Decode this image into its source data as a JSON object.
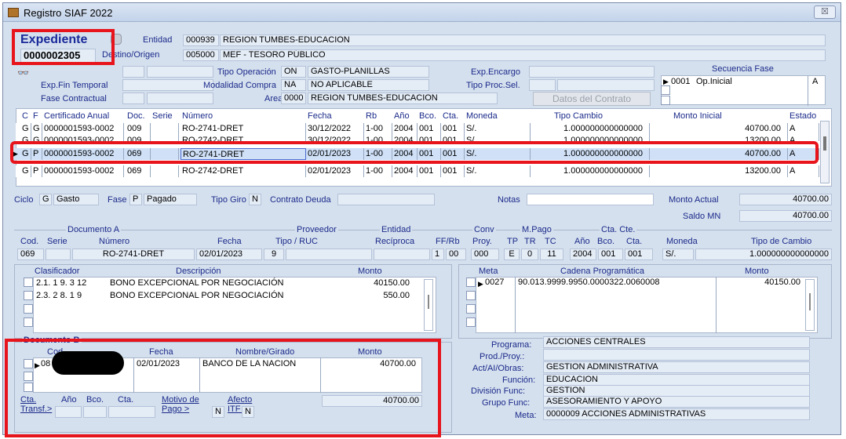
{
  "window": {
    "title": "Registro SIAF 2022",
    "close_label": "☒"
  },
  "expediente": {
    "label": "Expediente",
    "number": "0000002305",
    "entidad_label": "Entidad",
    "entidad_code": "000939",
    "entidad_name": "REGION TUMBES-EDUCACION",
    "destino_label": "Destino/Origen",
    "destino_code": "005000",
    "destino_name": "MEF - TESORO PÚBLICO"
  },
  "header": {
    "tipo_operacion_label": "Tipo Operación",
    "tipo_operacion_code": "ON",
    "tipo_operacion_value": "GASTO-PLANILLAS",
    "exp_encargo_label": "Exp.Encargo",
    "exp_fin_temporal_label": "Exp.Fin Temporal",
    "modalidad_compra_label": "Modalidad Compra",
    "modalidad_compra_code": "NA",
    "modalidad_compra_value": "NO APLICABLE",
    "tipo_proc_sel_label": "Tipo Proc.Sel.",
    "fase_contractual_label": "Fase Contractual",
    "area_label": "Area",
    "area_code": "0000",
    "area_value": "REGION TUMBES-EDUCACION",
    "datos_contrato_label": "Datos del Contrato"
  },
  "secuencia": {
    "title": "Secuencia Fase",
    "code": "0001",
    "name": "Op.Inicial",
    "state": "A"
  },
  "grid": {
    "headers": [
      "C",
      "F",
      "Certificado Anual",
      "Doc.",
      "Serie",
      "Número",
      "Fecha",
      "Rb",
      "Año",
      "Bco.",
      "Cta.",
      "Moneda",
      "Tipo Cambio",
      "Monto Inicial",
      "Estado"
    ],
    "rows": [
      [
        "G",
        "G",
        "0000001593-0002",
        "009",
        "",
        "RO-2741-DRET",
        "30/12/2022",
        "1-00",
        "2004",
        "001",
        "001",
        "S/.",
        "1.000000000000000",
        "40700.00",
        "A"
      ],
      [
        "G",
        "G",
        "0000001593-0002",
        "009",
        "",
        "RO-2742-DRET",
        "30/12/2022",
        "1-00",
        "2004",
        "001",
        "001",
        "S/.",
        "1.000000000000000",
        "13200.00",
        "A"
      ],
      [
        "G",
        "P",
        "0000001593-0002",
        "069",
        "",
        "RO-2741-DRET",
        "02/01/2023",
        "1-00",
        "2004",
        "001",
        "001",
        "S/.",
        "1.000000000000000",
        "40700.00",
        "A"
      ],
      [
        "G",
        "P",
        "0000001593-0002",
        "069",
        "",
        "RO-2742-DRET",
        "02/01/2023",
        "1-00",
        "2004",
        "001",
        "001",
        "S/.",
        "1.000000000000000",
        "13200.00",
        "A"
      ]
    ]
  },
  "summary": {
    "ciclo_label": "Ciclo",
    "ciclo_code": "G",
    "ciclo_value": "Gasto",
    "fase_label": "Fase",
    "fase_code": "P",
    "fase_value": "Pagado",
    "tipo_giro_label": "Tipo Giro",
    "tipo_giro_code": "N",
    "contrato_deuda_label": "Contrato Deuda",
    "notas_label": "Notas",
    "monto_actual_label": "Monto Actual",
    "monto_actual_value": "40700.00",
    "saldo_mn_label": "Saldo MN",
    "saldo_mn_value": "40700.00"
  },
  "documento": {
    "group_label": "Documento A",
    "proveedor_label": "Proveedor",
    "entidad_label": "Entidad",
    "conv_label": "Conv",
    "mpago_label": "M.Pago",
    "cta_cte_label": "Cta. Cte.",
    "col_cod": "Cod.",
    "col_serie": "Serie",
    "col_numero": "Número",
    "col_fecha": "Fecha",
    "col_tipo_ruc": "Tipo / RUC",
    "col_reciproca": "Recíproca",
    "col_ffrb": "FF/Rb",
    "col_proy": "Proy.",
    "col_tp": "TP",
    "col_tr": "TR",
    "col_tc": "TC",
    "col_anio": "Año",
    "col_bco": "Bco.",
    "col_cta": "Cta.",
    "col_moneda": "Moneda",
    "col_tipo_cambio": "Tipo de Cambio",
    "cod": "069",
    "numero": "RO-2741-DRET",
    "fecha": "02/01/2023",
    "tipo": "9",
    "ff": "1",
    "rb": "00",
    "proy": "000",
    "tp": "E",
    "tr": "0",
    "tc": "11",
    "anio": "2004",
    "bco": "001",
    "cta": "001",
    "moneda": "S/.",
    "tipo_cambio": "1.000000000000000"
  },
  "clasificador": {
    "col_clasificador": "Clasificador",
    "col_descripcion": "Descripción",
    "col_monto": "Monto",
    "rows": [
      {
        "code": "2.1. 1 9. 3 12",
        "desc": "BONO EXCEPCIONAL POR NEGOCIACIÓN",
        "monto": "40150.00"
      },
      {
        "code": "2.3. 2 8. 1 9",
        "desc": "BONO EXCEPCIONAL POR NEGOCIACIÓN",
        "monto": "550.00"
      }
    ]
  },
  "meta": {
    "col_meta": "Meta",
    "col_cadena": "Cadena Programática",
    "col_monto": "Monto",
    "code": "0027",
    "cadena": "90.013.9999.9950.0000322.0060008",
    "monto": "40150.00"
  },
  "documento_b": {
    "group_label": "Documento B",
    "col_cod": "Cod.",
    "col_fecha": "Fecha",
    "col_nombre": "Nombre/Girado",
    "col_monto": "Monto",
    "cod": "08",
    "fecha": "02/01/2023",
    "nombre": "BANCO DE LA NACION",
    "monto": "40700.00",
    "total": "40700.00",
    "cta_transf_label": "Cta. Transf.>",
    "anio_label": "Año",
    "bco_label": "Bco.",
    "cta_label": "Cta.",
    "motivo_label": "Motivo de Pago >",
    "motivo_value": "N",
    "afecto_label": "Afecto ITF >",
    "afecto_value": "N"
  },
  "programa": {
    "programa_label": "Programa:",
    "programa_value": "ACCIONES CENTRALES",
    "prod_label": "Prod./Proy.:",
    "act_label": "Act/AI/Obras:",
    "act_value": "GESTION ADMINISTRATIVA",
    "funcion_label": "Función:",
    "funcion_value": "EDUCACION",
    "division_label": "División Func:",
    "division_value": "GESTION",
    "grupo_label": "Grupo Func:",
    "grupo_value": "ASESORAMIENTO Y APOYO",
    "meta_label": "Meta:",
    "meta_value": "0000009 ACCIONES ADMINISTRATIVAS"
  },
  "colors": {
    "window_bg": "#d5e0ee",
    "label_blue": "#1a2a8a",
    "highlight_red": "#e8141c",
    "selected_row": "#cfe0f7"
  }
}
